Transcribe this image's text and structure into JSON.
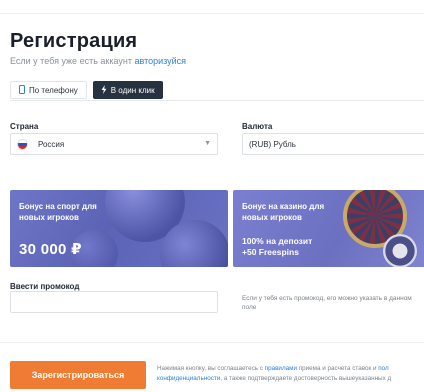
{
  "header": {
    "title": "Регистрация",
    "subtitle_prefix": "Если у тебя уже есть аккаунт",
    "login_link": "авторизуйся"
  },
  "tabs": [
    {
      "label": "По телефону",
      "icon": "phone-icon",
      "active": false
    },
    {
      "label": "В один клик",
      "icon": "lightning-icon",
      "active": true
    }
  ],
  "form": {
    "country_label": "Страна",
    "country_value": "Россия",
    "currency_label": "Валюта",
    "currency_value": "(RUB) Рубль",
    "promo_label": "Ввести промокод",
    "promo_value": "",
    "promo_hint": "Если у тебя есть промокод, его можно указать в данном поле"
  },
  "bonuses": {
    "sport": {
      "title": "Бонус на спорт для новых игроков",
      "amount": "30 000 ₽"
    },
    "casino": {
      "title": "Бонус на казино для новых игроков",
      "offer_line1": "100% на депозит",
      "offer_line2": "+50 Freespins"
    }
  },
  "footer": {
    "register_button": "Зарегистрироваться",
    "terms_line1_prefix": "Нажимая кнопку, вы соглашаетесь с",
    "terms_rules_link": "правилами",
    "terms_line1_suffix": "приема и расчета ставок и",
    "terms_line1_tail": "пол",
    "terms_privacy_link": "конфиденциальности",
    "terms_line2_suffix": ", а также подтверждаете достоверность вышеуказанных д"
  },
  "colors": {
    "accent_orange": "#f07b33",
    "active_tab": "#273240",
    "link_blue": "#2f7fd1",
    "sport_card": "#5b63b6",
    "casino_card": "#6b70c0"
  }
}
